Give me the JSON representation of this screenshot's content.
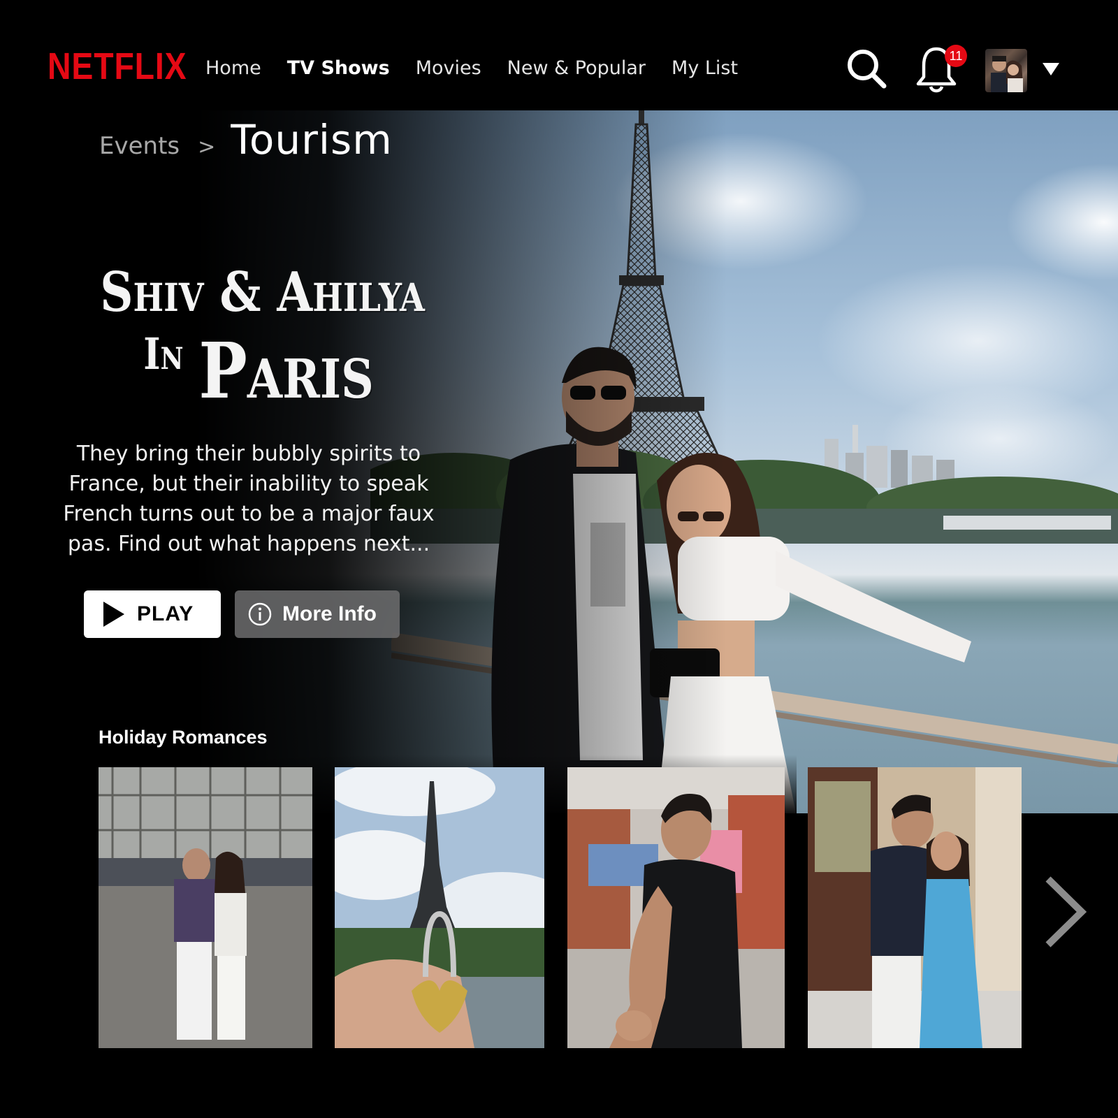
{
  "brand": {
    "logo_text": "NETFLIX",
    "color": "#e50914"
  },
  "nav": {
    "items": [
      {
        "label": "Home",
        "active": false
      },
      {
        "label": "TV Shows",
        "active": true
      },
      {
        "label": "Movies",
        "active": false
      },
      {
        "label": "New & Popular",
        "active": false
      },
      {
        "label": "My List",
        "active": false
      }
    ]
  },
  "header_actions": {
    "search_icon": "search-icon",
    "bell_icon": "bell-icon",
    "notification_count": "11",
    "avatar_icon": "profile-avatar",
    "caret_icon": "caret-down-icon"
  },
  "breadcrumb": {
    "parent": "Events",
    "separator": ">",
    "current": "Tourism"
  },
  "hero": {
    "title_line1": "Shiv & Ahilya",
    "title_small": "In",
    "title_big": "Paris",
    "synopsis": "They bring their bubbly spirits to France, but their inability to speak French turns out to be a major faux pas. Find out what happens next...",
    "play_label": "PLAY",
    "info_label": "More Info"
  },
  "row": {
    "title": "Holiday Romances",
    "tiles": [
      {
        "label": "Couple in front of cathedral"
      },
      {
        "label": "Love lock with Eiffel Tower"
      },
      {
        "label": "Man reaching out hand"
      },
      {
        "label": "Couple in doorway"
      }
    ],
    "next_icon": "chevron-right-icon"
  }
}
